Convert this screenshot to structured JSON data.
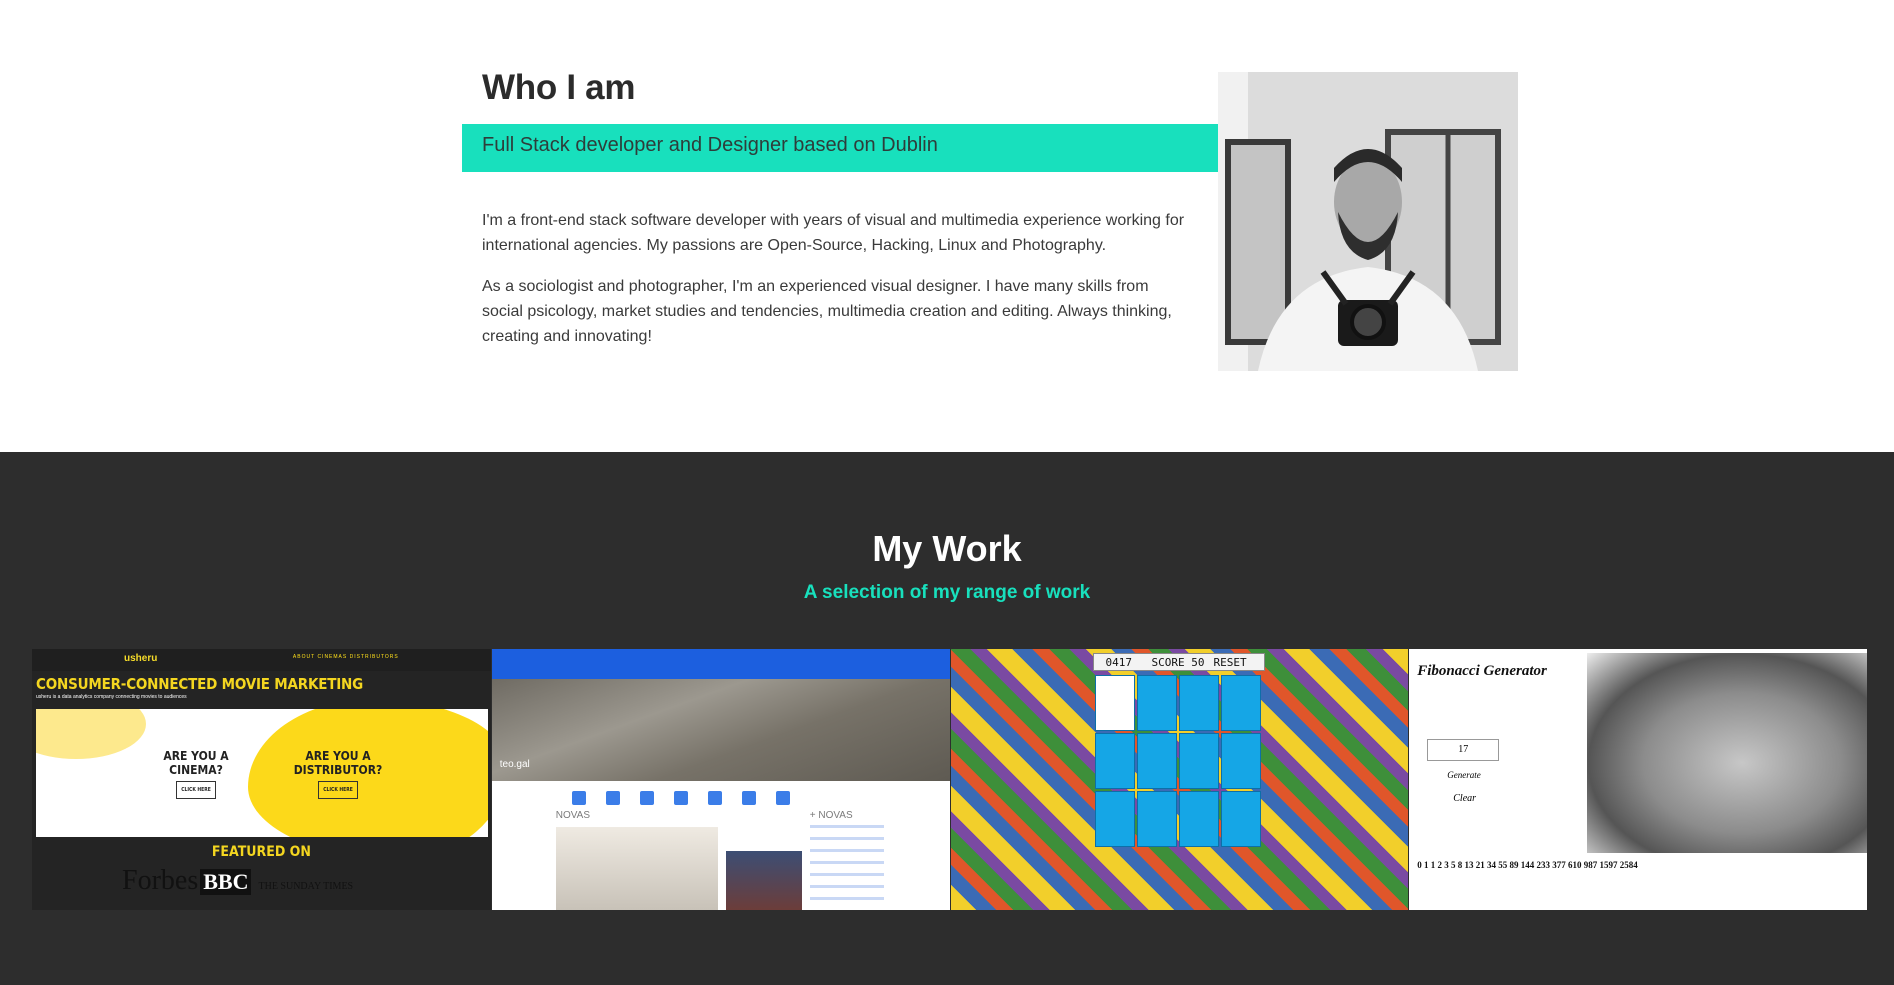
{
  "about": {
    "title": "Who I am",
    "tagline": "Full Stack developer and Designer based on Dublin",
    "paragraph_1": "I'm a front-end stack software developer with years of visual and multimedia experience working for international agencies. My passions are Open-Source, Hacking, Linux and Photography.",
    "paragraph_2": "As a sociologist and photographer, I'm an experienced visual designer. I have many skills from social psicology, market studies and tendencies, multimedia creation and editing. Always thinking, creating and innovating!"
  },
  "work": {
    "title": "My Work",
    "subtitle": "A selection of my range of work",
    "projects": [
      {
        "logo": "usheru",
        "menu": "ABOUT   CINEMAS   DISTRIBUTORS",
        "headline": "CONSUMER-CONNECTED MOVIE MARKETING",
        "tagline": "usheru is a data analytics company connecting movies to audiences",
        "ask_1": "ARE YOU A CINEMA?",
        "ask_2": "ARE YOU A DISTRIBUTOR?",
        "button": "CLICK HERE",
        "featured": "FEATURED ON",
        "press_1": "Forbes",
        "press_2": "BBC",
        "press_3": "THE SUNDAY TIMES"
      },
      {
        "hero": "teo.gal",
        "news": "NOVAS",
        "more_news": "+ NOVAS"
      },
      {
        "time": "0417",
        "score": "SCORE 50",
        "reset": "RESET"
      },
      {
        "title": "Fibonacci Generator",
        "input": "17",
        "generate": "Generate",
        "clear": "Clear",
        "sequence": "0 1 1 2 3 5 8 13 21 34 55 89 144 233 377 610 987 1597 2584"
      }
    ]
  },
  "colors": {
    "accent": "#18e0bd",
    "dark_bg": "#2d2d2d",
    "heading": "#2b2b2b"
  }
}
